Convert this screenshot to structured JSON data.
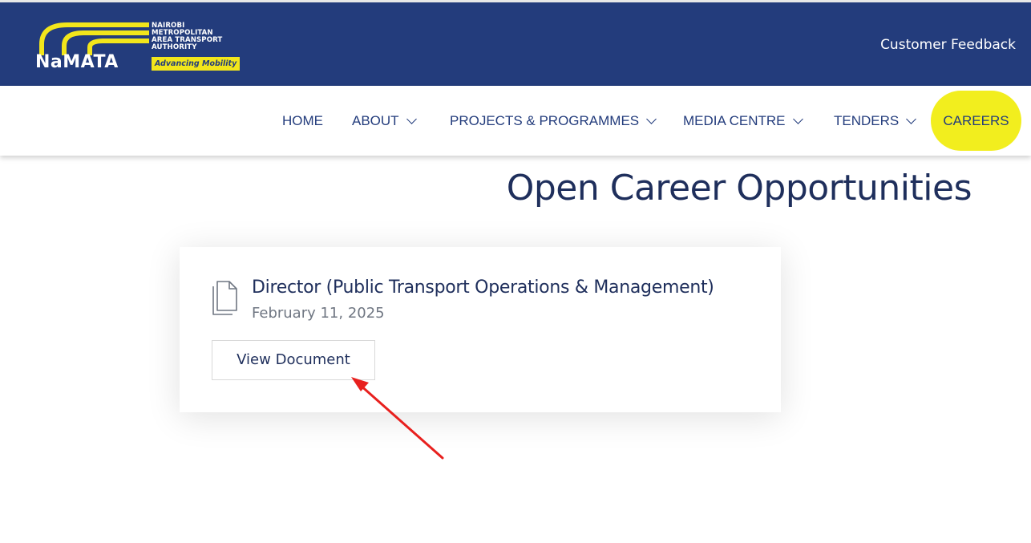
{
  "header": {
    "logo_word": "NaMATA",
    "logo_lines": [
      "NAIROBI",
      "METROPOLITAN",
      "AREA TRANSPORT",
      "AUTHORITY"
    ],
    "logo_tagline": "Advancing Mobility",
    "customer_feedback": "Customer Feedback"
  },
  "nav": {
    "home": "HOME",
    "about": "ABOUT",
    "projects": "PROJECTS & PROGRAMMES",
    "media": "MEDIA CENTRE",
    "tenders": "TENDERS",
    "careers": "CAREERS"
  },
  "page": {
    "title": "Open Career Opportunities"
  },
  "job": {
    "title": "Director (Public Transport Operations & Management)",
    "date": "February 11, 2025",
    "view_label": "View Document"
  },
  "colors": {
    "header_bg": "#233c7c",
    "accent_yellow": "#f2ee1e",
    "title_text": "#1f2f5c",
    "annotation_arrow": "#e8201e"
  },
  "icons": {
    "document": "document-icon",
    "chevron": "chevron-down-icon",
    "annotation": "red-arrow-icon"
  }
}
